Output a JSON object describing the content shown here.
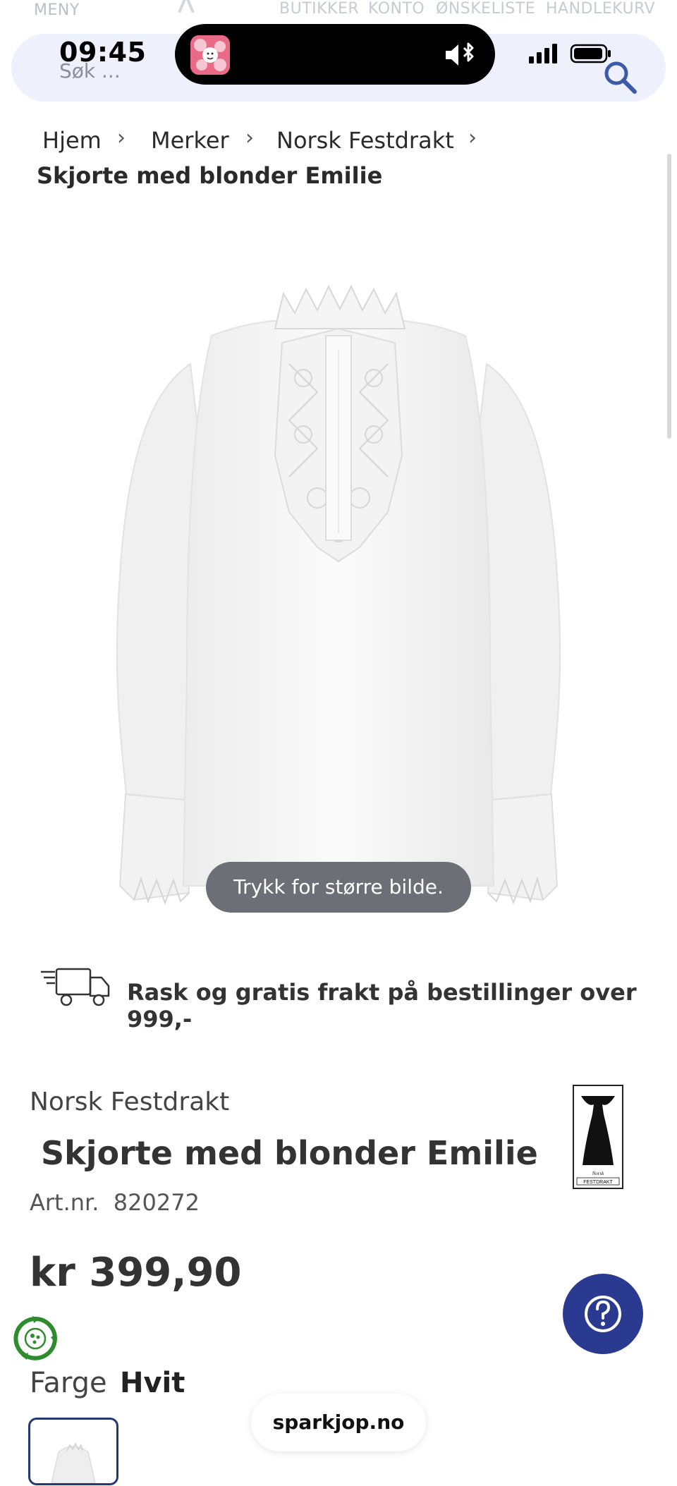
{
  "nav": {
    "menu": "MENY",
    "links": [
      "BUTIKKER",
      "KONTO",
      "ØNSKELISTE",
      "HANDLEKURV"
    ]
  },
  "status_bar": {
    "time": "09:45"
  },
  "search": {
    "placeholder": "Søk ..."
  },
  "breadcrumb": {
    "items": [
      "Hjem",
      "Merker",
      "Norsk Festdrakt"
    ],
    "separator": "›",
    "current": "Skjorte med blonder Emilie"
  },
  "product": {
    "image_hint": "Trykk for større bilde.",
    "shipping": "Rask og gratis frakt på bestillinger over 999,-",
    "brand": "Norsk Festdrakt",
    "title": "Skjorte med blonder Emilie",
    "artnr_label": "Art.nr.",
    "artnr": "820272",
    "price": "kr 399,90",
    "color_label": "Farge",
    "color_value": "Hvit",
    "brand_logo_text": "FESTDRAKT",
    "brand_logo_script": "Norsk"
  },
  "site": {
    "domain": "sparkjop.no"
  },
  "colors": {
    "help_button": "#2b3a91",
    "search_bar": "#eef0fb",
    "eco_green": "#2e8b2e",
    "swatch_border": "#253774"
  },
  "icons": [
    "search-icon",
    "truck-icon",
    "help-icon",
    "eco-badge-icon",
    "chevron-right-icon",
    "speaker-icon",
    "cell-signal-icon",
    "battery-icon"
  ]
}
